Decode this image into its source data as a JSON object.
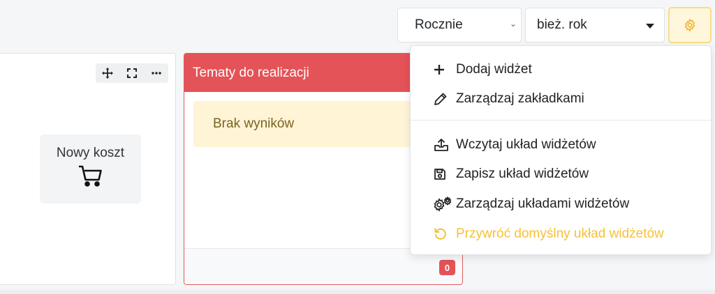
{
  "filters": {
    "period_value": "Rocznie",
    "year_value": "bież. rok"
  },
  "quick_tile": {
    "label": "Nowy koszt"
  },
  "topics_widget": {
    "title": "Tematy do realizacji",
    "empty_text": "Brak wyników",
    "count_badge": "0"
  },
  "menu": {
    "items": [
      {
        "label": "Dodaj widżet",
        "icon": "plus-icon"
      },
      {
        "label": "Zarządzaj zakładkami",
        "icon": "pencil-icon"
      },
      {
        "label": "Wczytaj układ widżetów",
        "icon": "upload-tray-icon"
      },
      {
        "label": "Zapisz układ widżetów",
        "icon": "floppy-disk-icon"
      },
      {
        "label": "Zarządzaj układami widżetów",
        "icon": "gears-icon"
      },
      {
        "label": "Przywróć domyślny układ widżetów",
        "icon": "undo-icon"
      }
    ]
  },
  "colors": {
    "danger": "#e45357",
    "warning": "#f5c139",
    "warning_bg": "#fff4d6"
  }
}
